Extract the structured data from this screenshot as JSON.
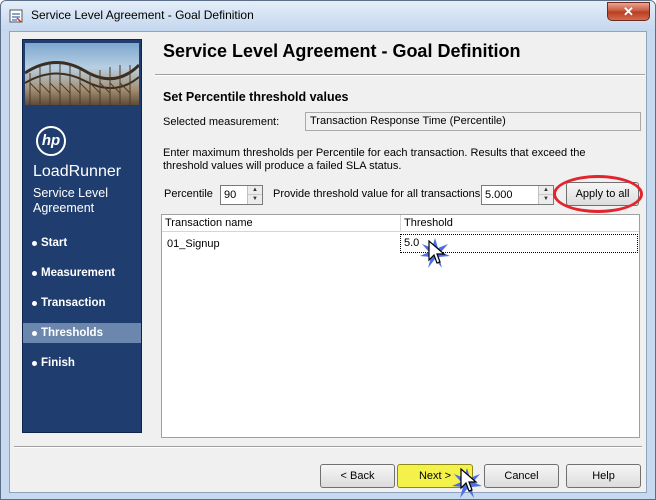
{
  "window": {
    "title": "Service Level Agreement - Goal Definition",
    "close_glyph": "✕"
  },
  "sidebar": {
    "logo_text": "hp",
    "brand": "LoadRunner",
    "subtitle": "Service Level Agreement",
    "items": [
      {
        "label": "Start",
        "active": false
      },
      {
        "label": "Measurement",
        "active": false
      },
      {
        "label": "Transaction",
        "active": false
      },
      {
        "label": "Thresholds",
        "active": true
      },
      {
        "label": "Finish",
        "active": false
      }
    ]
  },
  "main": {
    "heading": "Service Level Agreement - Goal Definition",
    "section_title": "Set Percentile threshold values",
    "measurement_label": "Selected measurement:",
    "measurement_value": "Transaction Response Time (Percentile)",
    "instructions": "Enter maximum thresholds per Percentile for each transaction. Results that exceed the threshold values will produce a failed SLA status.",
    "percentile_label": "Percentile",
    "percentile_value": "90",
    "threshold_all_label": "Provide threshold value for all transactions:",
    "threshold_all_value": "5.000",
    "apply_button": "Apply to all",
    "grid": {
      "columns": [
        "Transaction name",
        "Threshold"
      ],
      "rows": [
        {
          "name": "01_Signup",
          "threshold": "5.0"
        }
      ]
    }
  },
  "footer": {
    "back_label": "< Back",
    "next_label": "Next >",
    "cancel_label": "Cancel",
    "help_label": "Help"
  },
  "colors": {
    "sidebar_bg": "#1f3e6f",
    "active_item": "#6b87ad",
    "highlight_ellipse": "#e2242c",
    "next_highlight": "#f4f14a"
  }
}
